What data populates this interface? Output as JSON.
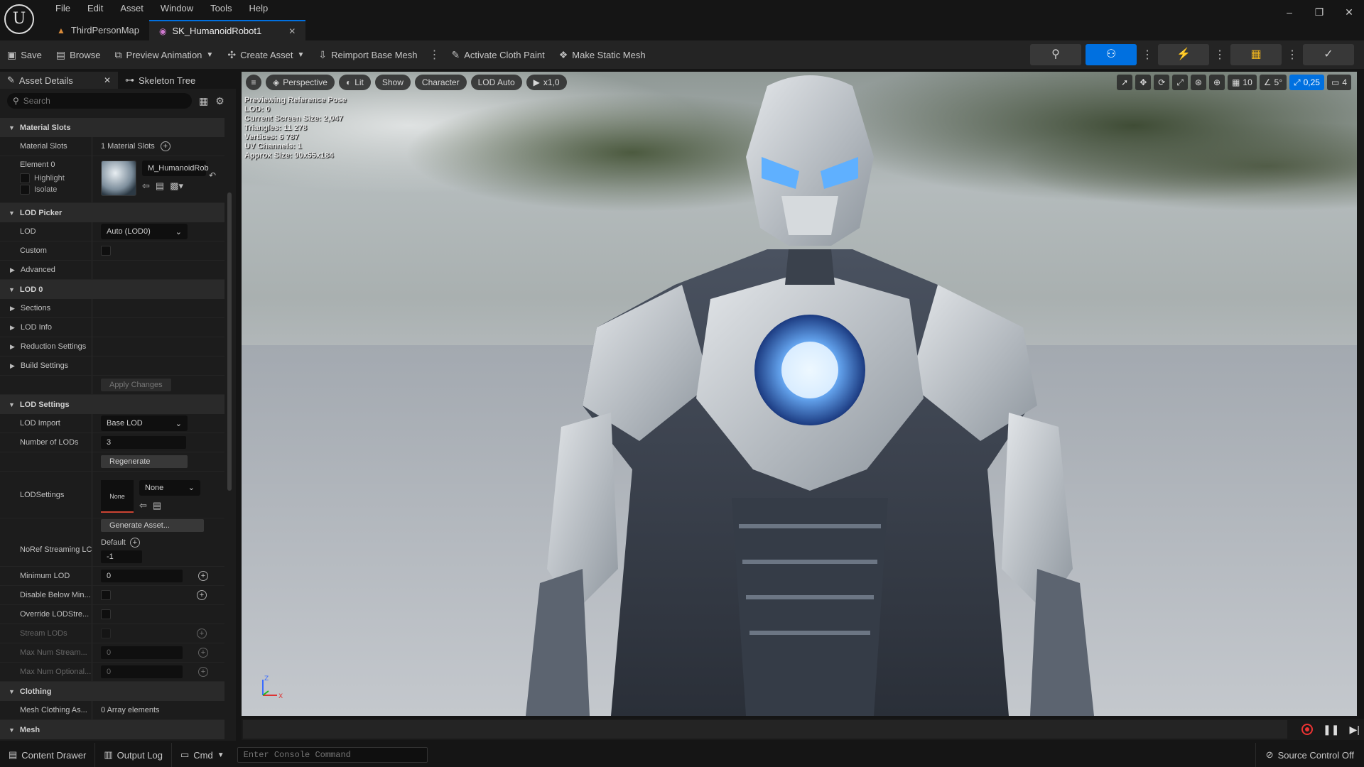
{
  "menu": [
    "File",
    "Edit",
    "Asset",
    "Window",
    "Tools",
    "Help"
  ],
  "doc_tabs": [
    {
      "label": "ThirdPersonMap"
    },
    {
      "label": "SK_HumanoidRobot1"
    }
  ],
  "toolbar": {
    "save": "Save",
    "browse": "Browse",
    "preview_animation": "Preview Animation",
    "create_asset": "Create Asset",
    "reimport": "Reimport Base Mesh",
    "cloth_paint": "Activate Cloth Paint",
    "static_mesh": "Make Static Mesh"
  },
  "details": {
    "tab_asset": "Asset Details",
    "tab_skeleton": "Skeleton Tree",
    "search_placeholder": "Search",
    "sec_material_slots": "Material Slots",
    "material_slots_label": "Material Slots",
    "material_slots_value": "1 Material Slots",
    "element0": "Element 0",
    "highlight": "Highlight",
    "isolate": "Isolate",
    "material_name": "M_HumanoidRob",
    "sec_lod_picker": "LOD Picker",
    "lod_label": "LOD",
    "lod_value": "Auto (LOD0)",
    "custom": "Custom",
    "advanced": "Advanced",
    "sec_lod0": "LOD 0",
    "sections": "Sections",
    "lod_info": "LOD Info",
    "reduction": "Reduction Settings",
    "build": "Build Settings",
    "apply": "Apply Changes",
    "sec_lod_settings": "LOD Settings",
    "lod_import": "LOD Import",
    "lod_import_value": "Base LOD",
    "num_lods": "Number of LODs",
    "num_lods_value": "3",
    "regenerate": "Regenerate",
    "lodsettings": "LODSettings",
    "lodsettings_thumb": "None",
    "lodsettings_value": "None",
    "generate_asset": "Generate Asset...",
    "noref": "NoRef Streaming LC",
    "noref_default": "Default",
    "noref_value": "-1",
    "min_lod": "Minimum LOD",
    "min_lod_value": "0",
    "disable_below": "Disable Below Min...",
    "override": "Override LODStre...",
    "stream_lods": "Stream LODs",
    "max_stream": "Max Num Stream...",
    "max_stream_value": "0",
    "max_optional": "Max Num Optional...",
    "max_optional_value": "0",
    "sec_clothing": "Clothing",
    "mesh_clothing": "Mesh Clothing As...",
    "mesh_clothing_value": "0 Array elements",
    "sec_mesh": "Mesh"
  },
  "viewport": {
    "perspective": "Perspective",
    "lit": "Lit",
    "show": "Show",
    "character": "Character",
    "lod_auto": "LOD Auto",
    "speed": "x1,0",
    "grid": "10",
    "angle": "5°",
    "scale": "0,25",
    "cam": "4",
    "stats": [
      "Previewing Reference Pose",
      "LOD: 0",
      "Current Screen Size: 2,047",
      "Triangles: 11 278",
      "Vertices: 6 787",
      "UV Channels: 1",
      "Approx Size: 90x55x184"
    ]
  },
  "statusbar": {
    "content_drawer": "Content Drawer",
    "output_log": "Output Log",
    "cmd": "Cmd",
    "console_placeholder": "Enter Console Command",
    "source_control": "Source Control Off"
  },
  "colors": {
    "accent": "#0070e0",
    "bg": "#151515",
    "panel": "#1c1c1c"
  }
}
